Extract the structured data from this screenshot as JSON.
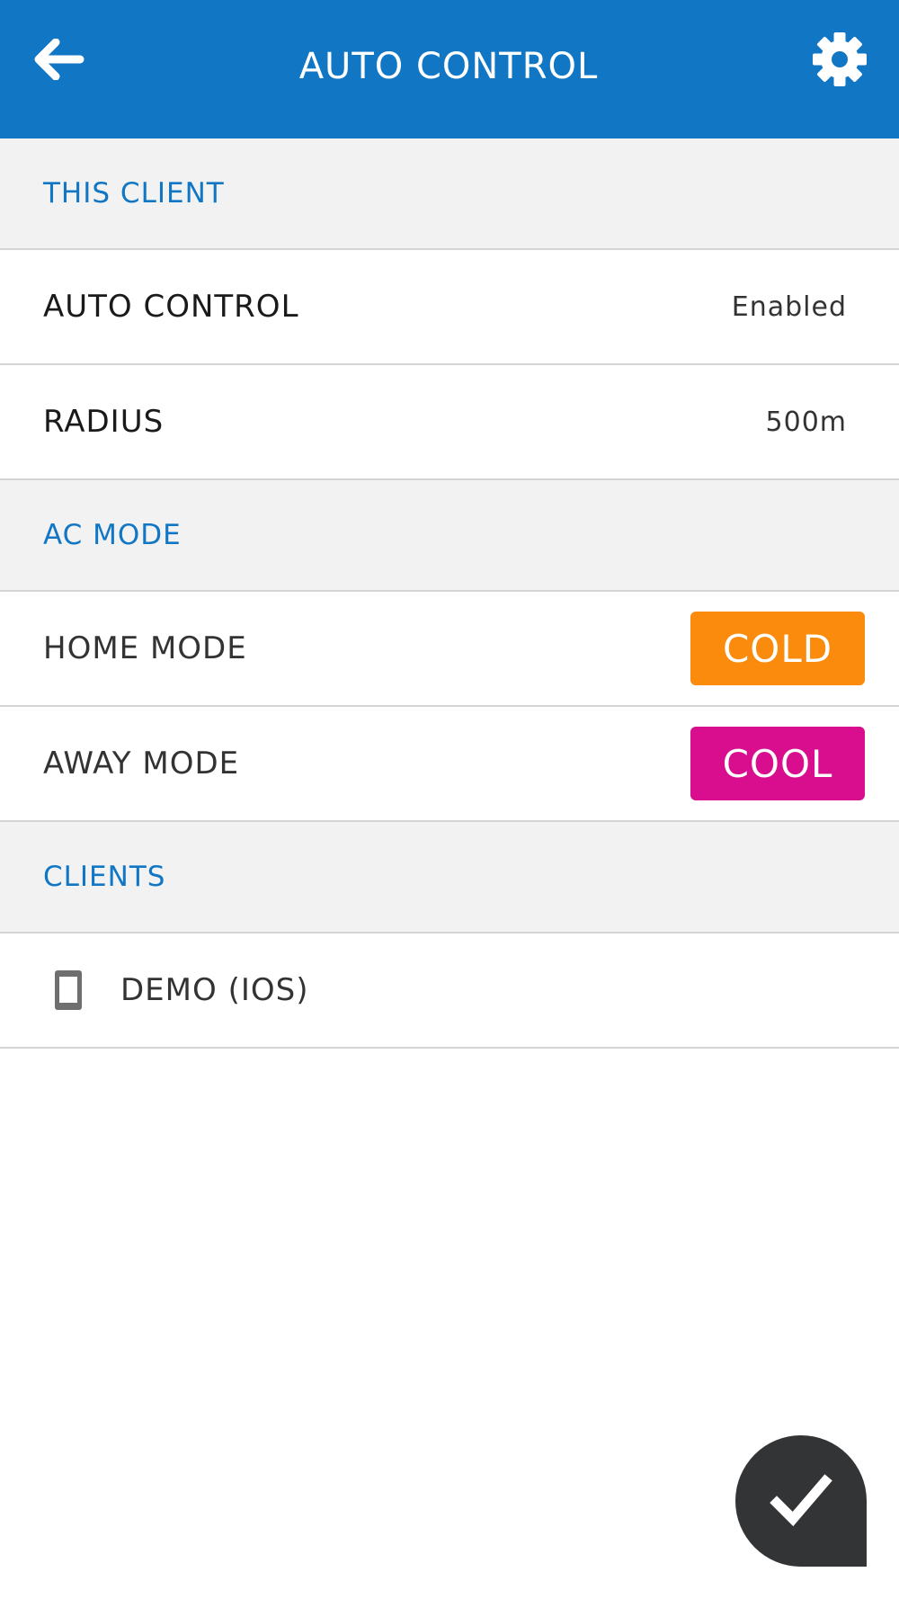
{
  "header": {
    "title": "AUTO CONTROL",
    "back_icon": "arrow-left-icon",
    "settings_icon": "gear-icon",
    "background_color": "#1176c4"
  },
  "sections": {
    "this_client": {
      "title": "THIS CLIENT",
      "auto_control": {
        "label": "AUTO CONTROL",
        "value": "Enabled"
      },
      "radius": {
        "label": "RADIUS",
        "value": "500m"
      }
    },
    "ac_mode": {
      "title": "AC MODE",
      "home_mode": {
        "label": "HOME MODE",
        "value": "COLD",
        "color": "#fb8b0d"
      },
      "away_mode": {
        "label": "AWAY MODE",
        "value": "COOL",
        "color": "#d80e8e"
      }
    },
    "clients": {
      "title": "CLIENTS",
      "items": [
        {
          "label": "DEMO (IOS)",
          "icon": "smartphone-icon"
        }
      ]
    }
  },
  "fab": {
    "icon": "checkmark-icon",
    "color": "#333436"
  }
}
